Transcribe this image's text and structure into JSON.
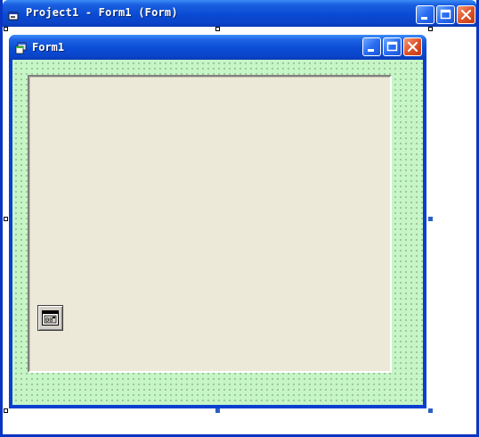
{
  "outer_window": {
    "title": "Project1 - Form1 (Form)",
    "icon": "form-designer-icon",
    "buttons": [
      "minimize",
      "maximize",
      "close"
    ]
  },
  "form_window": {
    "title": "Form1",
    "icon": "vb-form-icon",
    "buttons": [
      "minimize",
      "maximize",
      "close"
    ],
    "background_color": "#c6f5c6"
  },
  "controls": {
    "frame": {
      "type": "Frame",
      "background_color": "#ece9d8"
    },
    "timer": {
      "type": "Timer",
      "icon": "timer-control-icon"
    }
  },
  "colors": {
    "titlebar": "#0a4ad4",
    "close_button": "#e0532a",
    "selection_handle": "#2b5fc4"
  }
}
